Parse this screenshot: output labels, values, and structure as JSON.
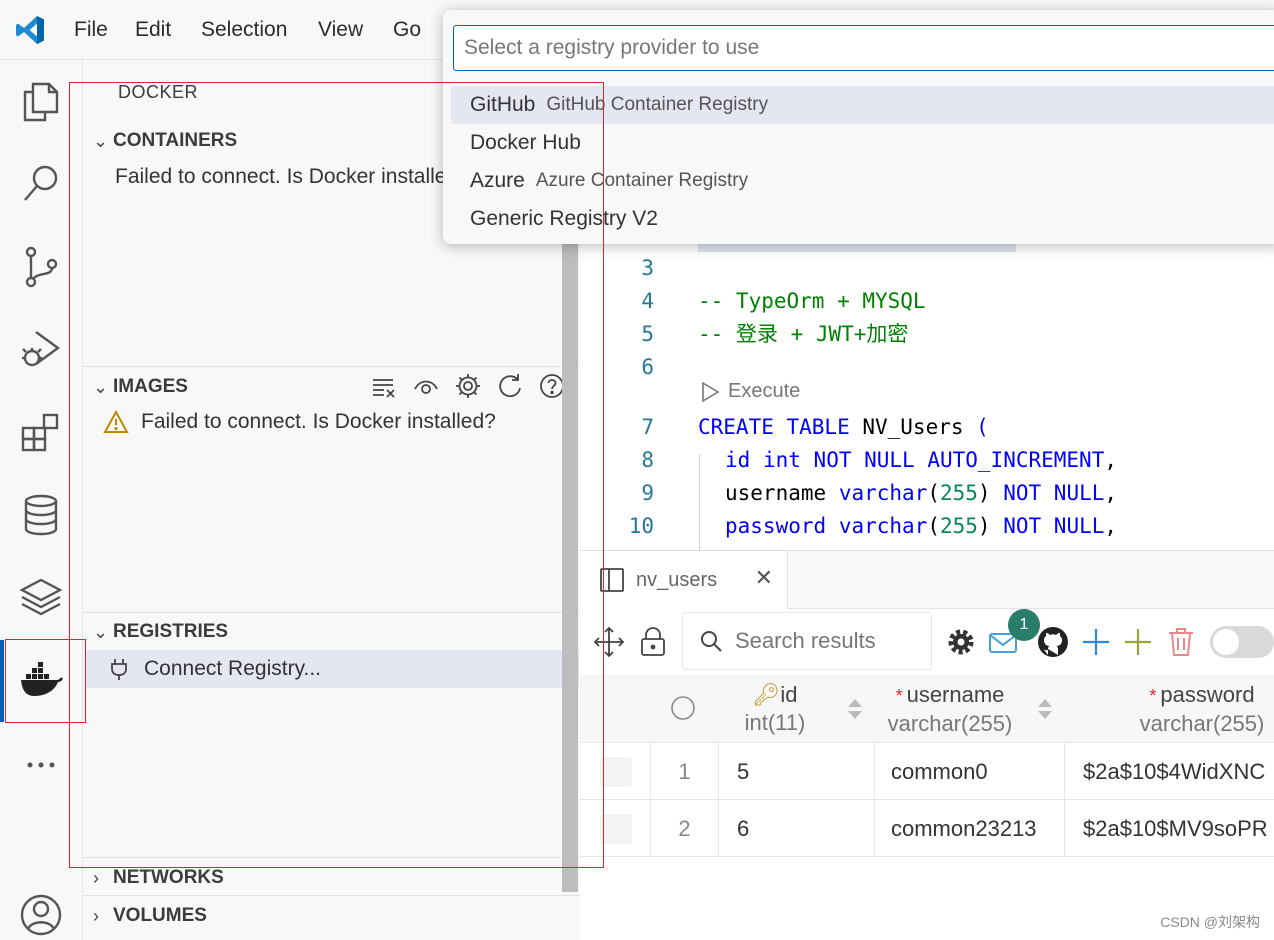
{
  "menu": [
    "File",
    "Edit",
    "Selection",
    "View",
    "Go"
  ],
  "quick_pick": {
    "placeholder": "Select a registry provider to use",
    "items": [
      {
        "label": "GitHub",
        "description": "GitHub Container Registry"
      },
      {
        "label": "Docker Hub",
        "description": ""
      },
      {
        "label": "Azure",
        "description": "Azure Container Registry"
      },
      {
        "label": "Generic Registry V2",
        "description": ""
      }
    ]
  },
  "sidebar": {
    "title": "DOCKER",
    "containers": {
      "title": "CONTAINERS",
      "message": "Failed to connect. Is Docker installed?"
    },
    "images": {
      "title": "IMAGES",
      "message": "Failed to connect. Is Docker installed?"
    },
    "registries": {
      "title": "REGISTRIES",
      "item": "Connect Registry..."
    },
    "networks": {
      "title": "NETWORKS"
    },
    "volumes": {
      "title": "VOLUMES"
    }
  },
  "editor": {
    "execute_label": "Execute",
    "lines": [
      {
        "num": "3"
      },
      {
        "num": "4",
        "text": "-- TypeOrm + MYSQL"
      },
      {
        "num": "5",
        "text": "-- 登录 + JWT+加密"
      },
      {
        "num": "6"
      },
      {
        "num": "7",
        "kw1": "CREATE TABLE",
        "name": " NV_Users ",
        "paren": "("
      },
      {
        "num": "8",
        "c1": "id",
        "c2": "int",
        "c3": "NOT NULL AUTO_INCREMENT",
        "end": ","
      },
      {
        "num": "9",
        "c1": "username",
        "c2": "varchar",
        "c3": "255",
        "c4": "NOT NULL",
        "end": ","
      },
      {
        "num": "10",
        "c1": "password",
        "c2": "varchar",
        "c3": "255",
        "c4": "NOT NULL",
        "end": ","
      }
    ]
  },
  "results": {
    "tab_label": "nv_users",
    "search_placeholder": "Search results",
    "badge_count": "1",
    "columns": [
      {
        "name": "id",
        "type": "int(11)"
      },
      {
        "name": "username",
        "type": "varchar(255)"
      },
      {
        "name": "password",
        "type": "varchar(255)"
      }
    ],
    "rows": [
      {
        "index": "1",
        "id": "5",
        "username": "common0",
        "password": "$2a$10$4WidXNC"
      },
      {
        "index": "2",
        "id": "6",
        "username": "common23213",
        "password": "$2a$10$MV9soPR"
      }
    ]
  },
  "watermark": "CSDN @刘架构",
  "colors": {
    "accent": "#005fb8",
    "highlight": "#d9262c",
    "keyword": "#0000ff",
    "comment": "#008000"
  }
}
